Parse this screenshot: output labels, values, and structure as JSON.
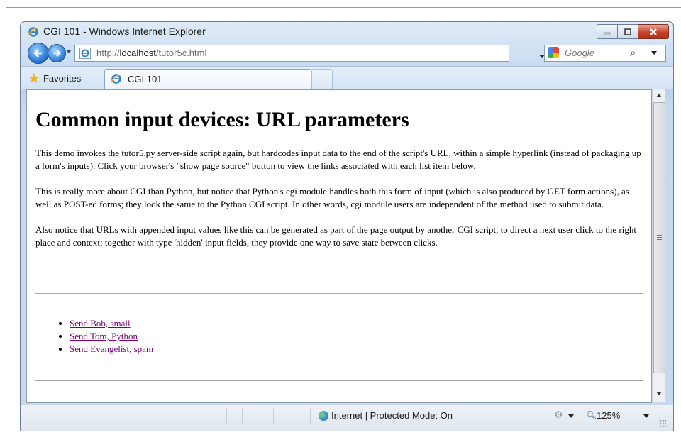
{
  "window": {
    "title": "CGI 101 - Windows Internet Explorer"
  },
  "navbar": {
    "url_prefix": "http://",
    "url_host": "localhost",
    "url_path": "/tutor5c.html",
    "search_placeholder": "Google"
  },
  "tabbar": {
    "favorites_label": "Favorites",
    "tab_title": "CGI 101"
  },
  "page": {
    "heading": "Common input devices: URL parameters",
    "paragraph1": "This demo invokes the tutor5.py server-side script again, but hardcodes input data to the end of the script's URL, within a simple hyperlink (instead of packaging up a form's inputs). Click your browser's \"show page source\" button to view the links associated with each list item below.",
    "paragraph2": "This is really more about CGI than Python, but notice that Python's cgi module handles both this form of input (which is also produced by GET form actions), as well as POST-ed forms; they look the same to the Python CGI script. In other words, cgi module users are independent of the method used to submit data.",
    "paragraph3": "Also notice that URLs with appended input values like this can be generated as part of the page output by another CGI script, to direct a next user click to the right place and context; together with type 'hidden' input fields, they provide one way to save state between clicks.",
    "links": [
      "Send Bob, small",
      "Send Tom, Python",
      "Send Evangelist, spam"
    ]
  },
  "statusbar": {
    "zone_text": "Internet | Protected Mode: On",
    "zoom": "125%"
  },
  "colors": {
    "visited_link": "#800080",
    "close_button": "#c7432a",
    "chrome_blue": "#c9dcf1"
  }
}
